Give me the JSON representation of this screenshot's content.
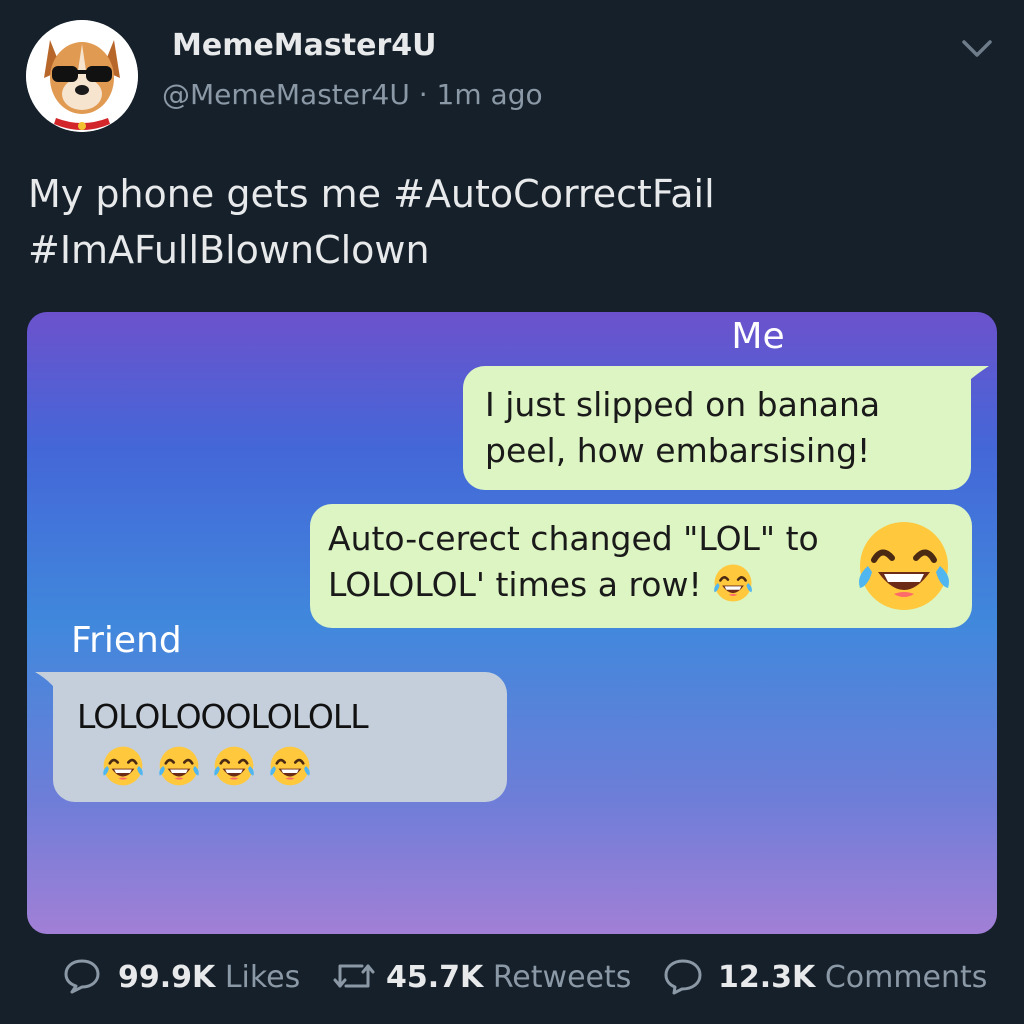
{
  "tweet": {
    "display_name": "MemeMaster4U",
    "handle": "@MemeMaster4U",
    "separator": "·",
    "time": "1m ago",
    "avatar_icon": "dog-with-sunglasses-avatar",
    "text_line1": "My phone gets me #AutoCorrectFail",
    "text_line2": "#ImAFullBlownClown"
  },
  "media": {
    "label_me": "Me",
    "label_friend": "Friend",
    "messages": [
      {
        "sender": "Me",
        "line1": "I just slipped on banana",
        "line2": "peel, how embarsising!"
      },
      {
        "sender": "Me",
        "line1": "Auto-cerect changed \"LOL\" to",
        "line2": "LOLOLOL' times a row!",
        "emoji": "face-with-tears-of-joy-icon"
      },
      {
        "sender": "Friend",
        "line1": "LOLOLOOOLOLOLL",
        "emoji": "face-with-tears-of-joy-icon"
      }
    ],
    "colors": {
      "sent": "#dcf5c2",
      "received": "#c5cfdc"
    }
  },
  "stats": {
    "likes_count": "99.9K",
    "likes_label": "Likes",
    "retweets_count": "45.7K",
    "retweets_label": "Retweets",
    "comments_count": "12.3K",
    "comments_label": "Comments"
  }
}
